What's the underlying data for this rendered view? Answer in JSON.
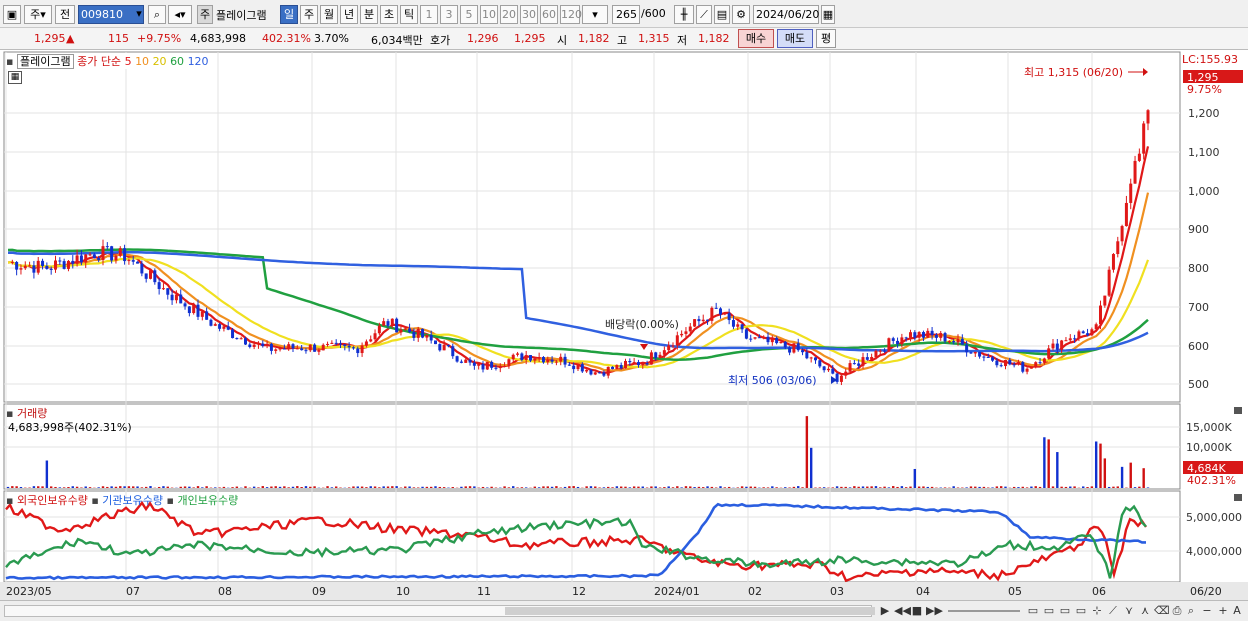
{
  "toolbar": {
    "market_type": "주",
    "market_all": "전",
    "stock_code": "009810",
    "stock_name_tag": "주",
    "stock_name": "플레이그램",
    "periods": [
      "일",
      "주",
      "월",
      "년",
      "분",
      "초",
      "틱"
    ],
    "active_period": "일",
    "intervals": [
      "1",
      "3",
      "5",
      "10",
      "20",
      "30",
      "60",
      "120"
    ],
    "count": "265",
    "count_total": "/600",
    "date": "2024/06/20"
  },
  "info": {
    "price": "1,295",
    "arrow": "▲",
    "change": "115",
    "change_pct": "+9.75%",
    "volume": "4,683,998",
    "vol_ratio": "402.31%",
    "turnover": "3.70%",
    "amount": "6,034백만",
    "quote_label": "호가",
    "ask": "1,296",
    "bid": "1,295",
    "open_label": "시",
    "open": "1,182",
    "high_label": "고",
    "high": "1,315",
    "low_label": "저",
    "low": "1,182",
    "buy": "매수",
    "sell": "매도",
    "eval": "평"
  },
  "price_panel": {
    "title": "플레이그램",
    "ma_label": "종가 단순",
    "ma_periods": [
      "5",
      "10",
      "20",
      "60",
      "120"
    ],
    "ma_colors": [
      "#e01818",
      "#f09020",
      "#f0e020",
      "#20a040",
      "#3060e0"
    ],
    "yaxis_ticks": [
      "1,200",
      "1,100",
      "1,000",
      "900",
      "800",
      "700",
      "600",
      "500"
    ],
    "lc_label": "LC:155.93",
    "current_price": "1,295",
    "current_pct": "9.75%",
    "high_annotation": "최고 1,315 (06/20)",
    "low_annotation": "최저 506 (03/06)",
    "dividend_annotation": "배당락(0.00%)"
  },
  "volume_panel": {
    "title": "거래량",
    "value": "4,683,998주(402.31%)",
    "yaxis_ticks": [
      "15,000K",
      "10,000K"
    ],
    "current": "4,684K",
    "current_pct": "402.31%"
  },
  "holdings_panel": {
    "series": [
      "외국인보유수량",
      "기관보유수량",
      "개인보유수량"
    ],
    "colors": [
      "#e01818",
      "#2060e0",
      "#20a040"
    ],
    "yaxis_ticks": [
      "5,000,000",
      "4,000,000"
    ]
  },
  "xaxis": [
    "2023/05",
    "07",
    "08",
    "09",
    "10",
    "11",
    "12",
    "2024/01",
    "02",
    "03",
    "04",
    "05",
    "06",
    "06/20"
  ]
}
